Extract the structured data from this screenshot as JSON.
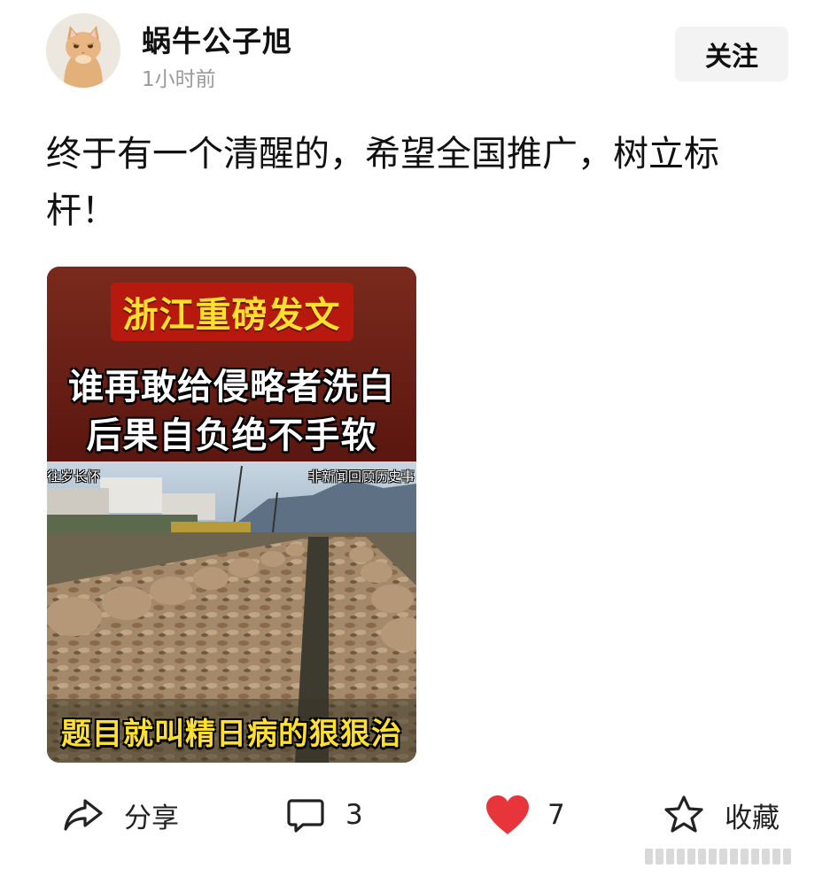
{
  "author": {
    "name": "蜗牛公子旭",
    "time": "1小时前",
    "avatar_icon": "cat-avatar-icon",
    "follow_label": "关注"
  },
  "post": {
    "text": "终于有一个清醒的，希望全国推广，树立标杆！",
    "image": {
      "title": "浙江重磅发文",
      "line1": "谁再敢给侵略者洗白",
      "line2": "后果自负绝不手软",
      "tag_left": "往岁长怀",
      "tag_right": "非新闻回顾历史事",
      "caption": "题目就叫精日病的狠狠治"
    }
  },
  "actions": {
    "share": {
      "icon": "share-icon",
      "label": "分享"
    },
    "comment": {
      "icon": "comment-icon",
      "count": "3"
    },
    "like": {
      "icon": "heart-icon",
      "count": "7",
      "color": "#e8353b"
    },
    "favorite": {
      "icon": "star-icon",
      "label": "收藏"
    }
  }
}
